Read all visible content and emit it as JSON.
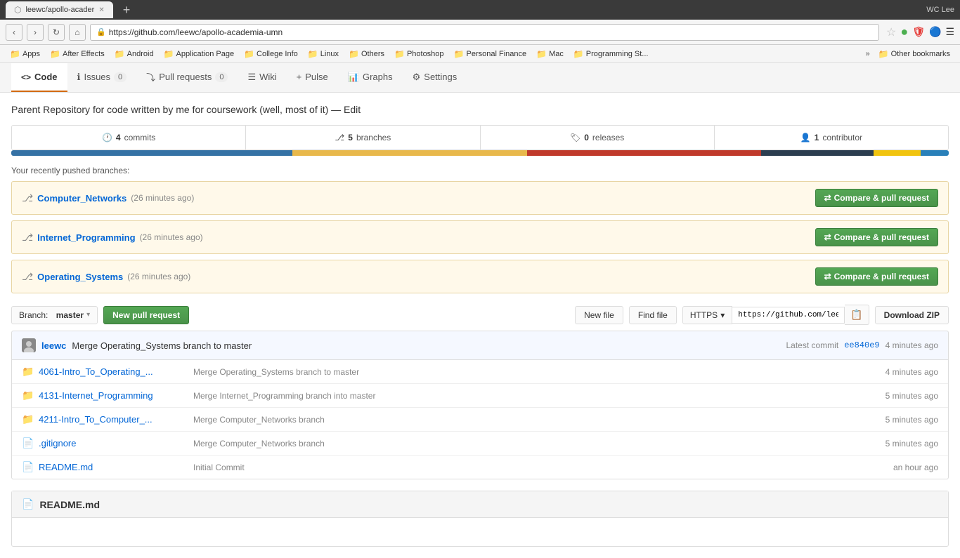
{
  "browser": {
    "tab": {
      "title": "leewc/apollo-acader",
      "favicon": "⬡"
    },
    "url": "https://github.com/leewc/apollo-academia-umn",
    "user": "WC Lee"
  },
  "bookmarks": {
    "items": [
      {
        "label": "Apps",
        "icon": "📁"
      },
      {
        "label": "After Effects",
        "icon": "📁"
      },
      {
        "label": "Android",
        "icon": "📁"
      },
      {
        "label": "Application Page",
        "icon": "📁"
      },
      {
        "label": "College Info",
        "icon": "📁"
      },
      {
        "label": "Linux",
        "icon": "📁"
      },
      {
        "label": "Others",
        "icon": "📁"
      },
      {
        "label": "Photoshop",
        "icon": "📁"
      },
      {
        "label": "Personal Finance",
        "icon": "📁"
      },
      {
        "label": "Mac",
        "icon": "📁"
      },
      {
        "label": "Programming St...",
        "icon": "📁"
      }
    ],
    "more_label": "»",
    "other_bookmarks": "Other bookmarks"
  },
  "github": {
    "nav": {
      "code_label": "Code",
      "issues_label": "Issues",
      "issues_count": "0",
      "pulls_label": "Pull requests",
      "pulls_count": "0",
      "wiki_label": "Wiki",
      "pulse_label": "Pulse",
      "graphs_label": "Graphs",
      "settings_label": "Settings"
    },
    "repo": {
      "description": "Parent Repository for code written by me for coursework (well, most of it) — Edit",
      "stats": {
        "commits_count": "4",
        "commits_label": "commits",
        "branches_count": "5",
        "branches_label": "branches",
        "releases_count": "0",
        "releases_label": "releases",
        "contributors_count": "1",
        "contributors_label": "contributor"
      },
      "color_bar": [
        {
          "color": "#3572A5",
          "width": "30%"
        },
        {
          "color": "#e8b84b",
          "width": "25%"
        },
        {
          "color": "#c0392b",
          "width": "25%"
        },
        {
          "color": "#2c3e50",
          "width": "12%"
        },
        {
          "color": "#f1c40f",
          "width": "5%"
        },
        {
          "color": "#2980b9",
          "width": "3%"
        }
      ],
      "recently_pushed_label": "Your recently pushed branches:",
      "branches": [
        {
          "name": "Computer_Networks",
          "time": "26 minutes ago",
          "compare_label": "Compare & pull request"
        },
        {
          "name": "Internet_Programming",
          "time": "26 minutes ago",
          "compare_label": "Compare & pull request"
        },
        {
          "name": "Operating_Systems",
          "time": "26 minutes ago",
          "compare_label": "Compare & pull request"
        }
      ],
      "toolbar": {
        "branch_label": "Branch:",
        "branch_name": "master",
        "new_pr_label": "New pull request",
        "new_file_label": "New file",
        "find_file_label": "Find file",
        "https_label": "HTTPS",
        "clone_url": "https://github.com/leewc.",
        "download_label": "Download ZIP"
      },
      "latest_commit": {
        "author": "leewc",
        "message": "Merge Operating_Systems branch to master",
        "label": "Latest commit",
        "sha": "ee840e9",
        "time": "4 minutes ago"
      },
      "files": [
        {
          "name": "4061-Intro_To_Operating_...",
          "type": "folder",
          "commit": "Merge Operating_Systems branch to master",
          "time": "4 minutes ago"
        },
        {
          "name": "4131-Internet_Programming",
          "type": "folder",
          "commit": "Merge Internet_Programming branch into master",
          "time": "5 minutes ago"
        },
        {
          "name": "4211-Intro_To_Computer_...",
          "type": "folder",
          "commit": "Merge Computer_Networks branch",
          "time": "5 minutes ago"
        },
        {
          "name": ".gitignore",
          "type": "file",
          "commit": "Merge Computer_Networks branch",
          "time": "5 minutes ago"
        },
        {
          "name": "README.md",
          "type": "file",
          "commit": "Initial Commit",
          "time": "an hour ago"
        }
      ],
      "readme": {
        "title": "README.md",
        "icon": "📄"
      }
    }
  }
}
